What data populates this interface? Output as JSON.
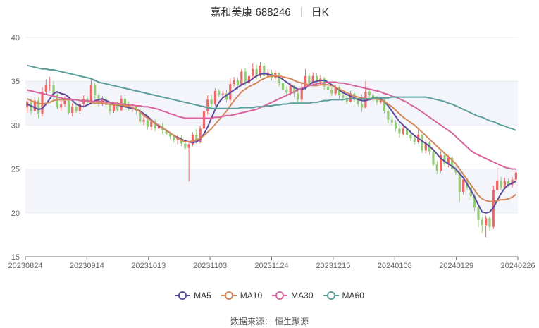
{
  "header": {
    "name": "嘉和美康 688246",
    "period": "日K"
  },
  "source": "数据来源： 恒生聚源",
  "colors": {
    "up": "#ee6666",
    "down": "#91cc75",
    "grid": "#e8ecf5",
    "band": "#f3f5fb",
    "axis": "#666666"
  },
  "chart_data": {
    "type": "candlestick",
    "ylim": [
      15,
      40
    ],
    "yticks": [
      15,
      20,
      25,
      30,
      35,
      40
    ],
    "xtick_labels": [
      "20230824",
      "20230914",
      "20231013",
      "20231103",
      "20231124",
      "20231215",
      "20240108",
      "20240129",
      "20240226"
    ],
    "candles": [
      [
        32.0,
        32.6,
        31.4,
        32.8
      ],
      [
        32.6,
        31.6,
        31.2,
        33.0
      ],
      [
        31.6,
        32.8,
        31.2,
        33.2
      ],
      [
        32.8,
        31.3,
        30.8,
        33.2
      ],
      [
        31.3,
        33.8,
        31.0,
        34.3
      ],
      [
        33.8,
        34.6,
        33.4,
        35.2
      ],
      [
        34.6,
        34.6,
        33.9,
        35.5
      ],
      [
        34.6,
        33.5,
        32.8,
        35.0
      ],
      [
        33.5,
        32.0,
        31.8,
        33.9
      ],
      [
        32.0,
        32.4,
        31.6,
        32.8
      ],
      [
        32.4,
        32.8,
        32.1,
        33.3
      ],
      [
        32.8,
        31.4,
        31.2,
        33.1
      ],
      [
        31.4,
        32.1,
        31.0,
        32.5
      ],
      [
        32.1,
        31.6,
        31.4,
        32.6
      ],
      [
        31.6,
        32.4,
        31.3,
        32.7
      ],
      [
        32.4,
        33.0,
        32.1,
        33.4
      ],
      [
        33.0,
        32.6,
        32.3,
        33.3
      ],
      [
        32.6,
        34.6,
        32.5,
        35.2
      ],
      [
        34.6,
        33.4,
        33.0,
        34.8
      ],
      [
        33.4,
        32.4,
        32.1,
        33.6
      ],
      [
        32.4,
        32.9,
        32.2,
        33.3
      ],
      [
        32.9,
        32.3,
        32.0,
        33.2
      ],
      [
        32.3,
        31.6,
        31.2,
        32.6
      ],
      [
        31.6,
        32.3,
        31.4,
        32.7
      ],
      [
        32.3,
        31.7,
        31.5,
        32.6
      ],
      [
        31.7,
        33.0,
        31.6,
        33.4
      ],
      [
        33.0,
        32.3,
        32.0,
        33.4
      ],
      [
        32.3,
        31.8,
        31.6,
        32.7
      ],
      [
        31.8,
        32.1,
        31.5,
        32.4
      ],
      [
        32.1,
        31.6,
        31.2,
        32.3
      ],
      [
        31.6,
        30.4,
        30.1,
        31.8
      ],
      [
        30.4,
        30.6,
        30.0,
        31.0
      ],
      [
        30.6,
        29.8,
        29.5,
        31.1
      ],
      [
        29.8,
        30.4,
        29.4,
        30.8
      ],
      [
        30.4,
        29.6,
        29.3,
        30.7
      ],
      [
        29.6,
        29.9,
        29.3,
        30.2
      ],
      [
        29.9,
        29.4,
        29.0,
        30.2
      ],
      [
        29.4,
        29.0,
        28.8,
        29.6
      ],
      [
        29.0,
        28.7,
        28.4,
        29.3
      ],
      [
        28.7,
        28.3,
        28.0,
        29.0
      ],
      [
        28.3,
        28.6,
        27.8,
        28.9
      ],
      [
        28.6,
        27.9,
        27.6,
        28.8
      ],
      [
        27.9,
        27.4,
        27.2,
        28.1
      ],
      [
        27.4,
        27.8,
        23.6,
        28.0
      ],
      [
        27.8,
        28.9,
        27.6,
        29.2
      ],
      [
        28.9,
        28.1,
        27.9,
        29.6
      ],
      [
        28.1,
        29.6,
        27.9,
        29.9
      ],
      [
        29.6,
        31.6,
        29.4,
        32.2
      ],
      [
        31.6,
        32.9,
        31.2,
        33.4
      ],
      [
        32.9,
        32.4,
        31.9,
        33.5
      ],
      [
        32.4,
        33.9,
        32.2,
        34.2
      ],
      [
        33.9,
        33.5,
        33.2,
        34.1
      ],
      [
        33.5,
        33.6,
        33.0,
        33.9
      ],
      [
        33.6,
        32.9,
        32.6,
        34.0
      ],
      [
        32.9,
        34.7,
        32.5,
        35.3
      ],
      [
        34.7,
        35.1,
        34.4,
        35.5
      ],
      [
        35.1,
        34.6,
        34.0,
        35.4
      ],
      [
        34.6,
        36.1,
        34.4,
        36.4
      ],
      [
        36.1,
        34.8,
        34.5,
        36.5
      ],
      [
        34.8,
        35.6,
        34.6,
        37.1
      ],
      [
        35.6,
        36.4,
        35.3,
        37.0
      ],
      [
        36.4,
        35.6,
        35.2,
        36.9
      ],
      [
        35.6,
        36.8,
        35.4,
        37.2
      ],
      [
        36.8,
        35.6,
        35.3,
        37.1
      ],
      [
        35.6,
        36.0,
        35.4,
        36.4
      ],
      [
        36.0,
        35.4,
        35.1,
        36.3
      ],
      [
        35.4,
        35.9,
        35.2,
        36.3
      ],
      [
        35.9,
        34.8,
        34.4,
        36.0
      ],
      [
        34.8,
        34.0,
        33.8,
        35.0
      ],
      [
        34.0,
        33.7,
        33.2,
        34.4
      ],
      [
        33.7,
        34.5,
        33.4,
        34.8
      ],
      [
        34.5,
        33.6,
        33.2,
        34.6
      ],
      [
        33.6,
        32.9,
        32.6,
        34.1
      ],
      [
        32.9,
        34.2,
        32.7,
        34.8
      ],
      [
        34.2,
        35.6,
        34.0,
        36.4
      ],
      [
        35.6,
        34.8,
        34.4,
        35.9
      ],
      [
        34.8,
        35.6,
        34.5,
        36.0
      ],
      [
        35.6,
        34.9,
        34.6,
        35.9
      ],
      [
        34.9,
        35.3,
        34.6,
        35.7
      ],
      [
        35.3,
        34.4,
        34.0,
        35.5
      ],
      [
        34.4,
        34.0,
        33.6,
        34.8
      ],
      [
        34.0,
        33.6,
        33.3,
        34.3
      ],
      [
        33.6,
        34.3,
        33.4,
        34.6
      ],
      [
        34.3,
        33.4,
        33.0,
        34.5
      ],
      [
        33.4,
        33.1,
        32.9,
        33.7
      ],
      [
        33.1,
        32.7,
        32.4,
        33.5
      ],
      [
        32.7,
        33.6,
        32.6,
        33.9
      ],
      [
        33.6,
        32.9,
        32.6,
        33.8
      ],
      [
        32.9,
        32.4,
        32.1,
        33.1
      ],
      [
        32.4,
        32.0,
        31.5,
        33.5
      ],
      [
        32.0,
        33.8,
        31.9,
        35.0
      ],
      [
        33.8,
        33.4,
        33.0,
        34.2
      ],
      [
        33.4,
        33.0,
        32.7,
        33.6
      ],
      [
        33.0,
        32.6,
        32.3,
        33.3
      ],
      [
        32.6,
        32.9,
        32.4,
        33.2
      ],
      [
        32.9,
        31.6,
        31.3,
        33.0
      ],
      [
        31.6,
        30.6,
        30.2,
        31.8
      ],
      [
        30.6,
        30.3,
        30.0,
        31.1
      ],
      [
        30.3,
        29.6,
        29.3,
        30.6
      ],
      [
        29.6,
        29.0,
        28.6,
        29.9
      ],
      [
        29.0,
        29.6,
        28.8,
        29.9
      ],
      [
        29.6,
        28.9,
        28.5,
        29.8
      ],
      [
        28.9,
        28.5,
        28.2,
        29.2
      ],
      [
        28.5,
        28.1,
        27.8,
        28.8
      ],
      [
        28.1,
        28.9,
        27.9,
        29.6
      ],
      [
        28.9,
        27.1,
        26.8,
        29.0
      ],
      [
        27.1,
        28.0,
        26.8,
        28.4
      ],
      [
        28.0,
        27.0,
        26.6,
        28.2
      ],
      [
        27.0,
        25.5,
        25.3,
        27.2
      ],
      [
        25.5,
        24.8,
        24.4,
        25.9
      ],
      [
        24.8,
        26.6,
        24.6,
        27.0
      ],
      [
        26.6,
        25.6,
        25.3,
        26.8
      ],
      [
        25.6,
        26.3,
        25.2,
        26.6
      ],
      [
        26.3,
        25.0,
        24.8,
        26.5
      ],
      [
        25.0,
        24.6,
        24.3,
        25.4
      ],
      [
        24.6,
        22.4,
        21.3,
        24.7
      ],
      [
        22.4,
        23.8,
        22.1,
        24.1
      ],
      [
        23.8,
        22.9,
        22.6,
        24.0
      ],
      [
        22.9,
        21.9,
        21.4,
        23.1
      ],
      [
        21.9,
        20.6,
        20.2,
        22.2
      ],
      [
        20.6,
        19.2,
        18.4,
        20.8
      ],
      [
        19.2,
        18.6,
        17.7,
        19.5
      ],
      [
        18.6,
        19.4,
        17.2,
        19.7
      ],
      [
        19.4,
        18.4,
        17.9,
        19.6
      ],
      [
        18.4,
        22.6,
        18.2,
        23.1
      ],
      [
        22.6,
        23.7,
        22.4,
        25.4
      ],
      [
        23.7,
        22.9,
        22.6,
        24.1
      ],
      [
        22.9,
        23.6,
        22.7,
        24.0
      ],
      [
        23.6,
        23.2,
        22.9,
        23.9
      ],
      [
        23.2,
        23.8,
        22.9,
        24.1
      ],
      [
        23.8,
        24.6,
        23.6,
        24.8
      ]
    ],
    "series": [
      {
        "name": "MA5",
        "color": "#5b4a9d",
        "values": [
          32.4,
          32.2,
          32.0,
          31.8,
          31.9,
          32.4,
          33.0,
          33.6,
          33.8,
          33.6,
          33.5,
          33.2,
          32.8,
          32.4,
          32.2,
          32.1,
          32.3,
          32.5,
          32.8,
          32.9,
          33.0,
          32.8,
          32.6,
          32.4,
          32.3,
          32.2,
          32.1,
          32.0,
          31.9,
          31.8,
          31.6,
          31.3,
          31.0,
          30.6,
          30.2,
          29.9,
          29.7,
          29.4,
          29.1,
          28.8,
          28.6,
          28.4,
          28.2,
          28.1,
          28.0,
          28.1,
          28.4,
          29.0,
          29.8,
          30.8,
          31.8,
          32.6,
          33.1,
          33.4,
          33.7,
          34.0,
          34.3,
          34.6,
          34.8,
          35.0,
          35.3,
          35.6,
          35.8,
          35.9,
          35.8,
          35.7,
          35.6,
          35.5,
          35.2,
          34.9,
          34.6,
          34.3,
          34.1,
          34.1,
          34.2,
          34.6,
          34.9,
          35.0,
          35.1,
          35.1,
          34.9,
          34.6,
          34.3,
          34.0,
          33.7,
          33.5,
          33.3,
          33.1,
          32.9,
          32.8,
          32.8,
          32.9,
          33.0,
          33.0,
          33.0,
          32.7,
          32.2,
          31.6,
          31.0,
          30.4,
          30.0,
          29.6,
          29.2,
          28.8,
          28.5,
          28.2,
          27.9,
          27.6,
          27.2,
          26.7,
          26.2,
          25.9,
          25.6,
          25.3,
          25.0,
          24.5,
          24.0,
          23.3,
          22.6,
          21.8,
          20.9,
          20.1,
          20.0,
          20.1,
          20.6,
          21.4,
          22.2,
          22.8,
          23.2,
          23.4,
          23.6
        ]
      },
      {
        "name": "MA10",
        "color": "#d4875a",
        "values": [
          33.0,
          32.8,
          32.6,
          32.5,
          32.4,
          32.5,
          32.6,
          32.8,
          32.9,
          32.9,
          32.9,
          32.9,
          32.9,
          32.9,
          32.8,
          32.8,
          32.7,
          32.6,
          32.5,
          32.5,
          32.5,
          32.4,
          32.4,
          32.3,
          32.3,
          32.3,
          32.2,
          32.2,
          32.0,
          31.8,
          31.5,
          31.1,
          30.8,
          30.5,
          30.2,
          30.0,
          29.7,
          29.4,
          29.1,
          28.8,
          28.5,
          28.3,
          28.1,
          28.1,
          28.2,
          28.3,
          28.5,
          28.8,
          29.2,
          29.6,
          30.1,
          30.6,
          31.1,
          31.6,
          32.2,
          32.8,
          33.3,
          33.8,
          34.1,
          34.4,
          34.6,
          34.8,
          35.1,
          35.3,
          35.5,
          35.6,
          35.6,
          35.6,
          35.5,
          35.4,
          35.3,
          35.1,
          34.9,
          34.8,
          34.7,
          34.6,
          34.5,
          34.5,
          34.6,
          34.6,
          34.6,
          34.5,
          34.3,
          34.1,
          33.9,
          33.7,
          33.5,
          33.3,
          33.2,
          33.1,
          33.0,
          33.0,
          33.0,
          33.0,
          32.9,
          32.7,
          32.4,
          32.1,
          31.7,
          31.3,
          30.9,
          30.6,
          30.3,
          30.0,
          29.6,
          29.2,
          28.8,
          28.4,
          28.0,
          27.6,
          27.2,
          26.8,
          26.4,
          26.0,
          25.6,
          25.0,
          24.4,
          23.8,
          23.2,
          22.6,
          22.0,
          21.6,
          21.4,
          21.3,
          21.3,
          21.4,
          21.5,
          21.5,
          21.6,
          21.8,
          22.1
        ]
      },
      {
        "name": "MA30",
        "color": "#d7649e",
        "values": [
          34.0,
          33.9,
          33.8,
          33.7,
          33.6,
          33.5,
          33.4,
          33.3,
          33.2,
          33.1,
          33.0,
          33.0,
          32.9,
          32.9,
          32.8,
          32.8,
          32.8,
          32.7,
          32.7,
          32.7,
          32.7,
          32.6,
          32.6,
          32.5,
          32.5,
          32.4,
          32.4,
          32.3,
          32.3,
          32.2,
          32.2,
          32.1,
          32.1,
          32.0,
          31.9,
          31.8,
          31.6,
          31.5,
          31.3,
          31.2,
          31.0,
          30.9,
          30.8,
          30.8,
          30.8,
          30.8,
          30.8,
          30.8,
          30.8,
          30.8,
          30.9,
          30.9,
          31.0,
          31.1,
          31.1,
          31.2,
          31.3,
          31.4,
          31.5,
          31.6,
          31.7,
          31.8,
          32.0,
          32.2,
          32.4,
          32.6,
          32.8,
          33.0,
          33.2,
          33.4,
          33.6,
          33.8,
          34.0,
          34.2,
          34.4,
          34.5,
          34.6,
          34.7,
          34.8,
          34.8,
          34.9,
          34.9,
          34.9,
          34.8,
          34.8,
          34.7,
          34.6,
          34.5,
          34.4,
          34.3,
          34.2,
          34.1,
          34.0,
          33.9,
          33.8,
          33.6,
          33.5,
          33.3,
          33.2,
          33.0,
          32.8,
          32.6,
          32.3,
          32.1,
          31.8,
          31.5,
          31.2,
          30.9,
          30.6,
          30.3,
          30.0,
          29.7,
          29.4,
          29.1,
          28.7,
          28.3,
          27.9,
          27.5,
          27.1,
          26.8,
          26.6,
          26.4,
          26.2,
          26.0,
          25.8,
          25.6,
          25.4,
          25.2,
          25.1,
          25.0,
          25.0
        ]
      },
      {
        "name": "MA60",
        "color": "#5b9e9c",
        "values": [
          36.8,
          36.7,
          36.6,
          36.5,
          36.4,
          36.4,
          36.3,
          36.3,
          36.2,
          36.1,
          36.0,
          35.9,
          35.8,
          35.7,
          35.6,
          35.5,
          35.4,
          35.3,
          35.1,
          34.9,
          34.8,
          34.7,
          34.6,
          34.5,
          34.4,
          34.3,
          34.2,
          34.1,
          34.0,
          33.9,
          33.8,
          33.7,
          33.6,
          33.5,
          33.4,
          33.3,
          33.2,
          33.1,
          33.0,
          32.9,
          32.8,
          32.7,
          32.6,
          32.5,
          32.4,
          32.3,
          32.2,
          32.1,
          32.0,
          31.9,
          31.9,
          31.9,
          31.9,
          31.9,
          31.9,
          31.9,
          31.9,
          32.0,
          32.0,
          32.0,
          32.0,
          32.1,
          32.1,
          32.1,
          32.2,
          32.2,
          32.3,
          32.3,
          32.4,
          32.4,
          32.5,
          32.5,
          32.5,
          32.5,
          32.5,
          32.5,
          32.6,
          32.6,
          32.7,
          32.8,
          32.8,
          32.9,
          32.9,
          32.9,
          32.9,
          33.0,
          33.0,
          33.0,
          33.0,
          33.0,
          33.0,
          33.0,
          33.1,
          33.1,
          33.1,
          33.1,
          33.1,
          33.2,
          33.2,
          33.2,
          33.2,
          33.2,
          33.2,
          33.2,
          33.2,
          33.2,
          33.2,
          33.1,
          33.0,
          32.9,
          32.8,
          32.7,
          32.5,
          32.4,
          32.2,
          32.0,
          31.8,
          31.6,
          31.4,
          31.2,
          31.0,
          30.9,
          30.7,
          30.5,
          30.4,
          30.2,
          30.0,
          29.9,
          29.7,
          29.6,
          29.4
        ]
      }
    ]
  }
}
